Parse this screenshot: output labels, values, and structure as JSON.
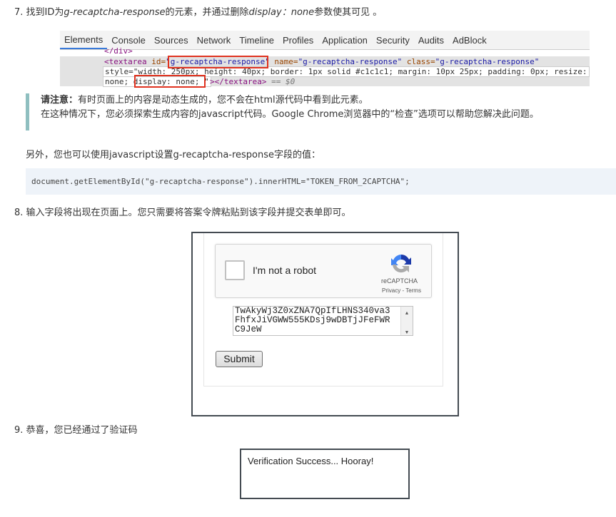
{
  "step7": {
    "num": "7.",
    "a": "找到ID为",
    "b": "g-recaptcha-response",
    "c": "的元素，并通过删除",
    "d": "display：none",
    "e": "参数使其可见 。"
  },
  "devtools": {
    "tabs": [
      "Elements",
      "Console",
      "Sources",
      "Network",
      "Timeline",
      "Profiles",
      "Application",
      "Security",
      "Audits",
      "AdBlock"
    ],
    "line0": "</div>",
    "open": "<textarea",
    "id_attr": " id=",
    "id_val": "g-recaptcha-response",
    "name_attr": " name=",
    "name_val": "\"g-recaptcha-response\"",
    "class_attr": " class=",
    "class_val": "\"g-recaptcha-response\"",
    "style_line": "style=\"width: 250px; height: 40px; border: 1px solid #c1c1c1; margin: 10px 25px; padding: 0px; resize:",
    "none1": "none; ",
    "display": "display: none;",
    "quote": " \"",
    "close": "></textarea>",
    "eq": " == $0",
    "line_end": "</div>"
  },
  "note": {
    "bold": "请注意：",
    "line1": "有时页面上的内容是动态生成的，您不会在html源代码中看到此元素。",
    "line2": "在这种情况下，您必须探索生成内容的javascript代码。Google Chrome浏览器中的“检查”选项可以帮助您解决此问题。"
  },
  "alt": "另外，您也可以使用javascript设置g-recaptcha-response字段的值：",
  "code": "document.getElementById(\"g-recaptcha-response\").innerHTML=\"TOKEN_FROM_2CAPTCHA\";",
  "step8": {
    "num": "8.",
    "text": "输入字段将出现在页面上。您只需要将答案令牌粘贴到该字段并提交表单即可。"
  },
  "recaptcha": {
    "label": "I'm not a robot",
    "brand": "reCAPTCHA",
    "links": "Privacy - Terms"
  },
  "textarea": {
    "lines": [
      "TwAkyWj3Z0xZNA7QpIfLHNS340va3",
      "FhfxJiVGWW555KDsj9wDBTjJFeFWR",
      "C9JeW"
    ]
  },
  "submit": "Submit",
  "step9": {
    "num": "9.",
    "text": "恭喜，您已经通过了验证码"
  },
  "success": "Verification Success... Hooray!"
}
